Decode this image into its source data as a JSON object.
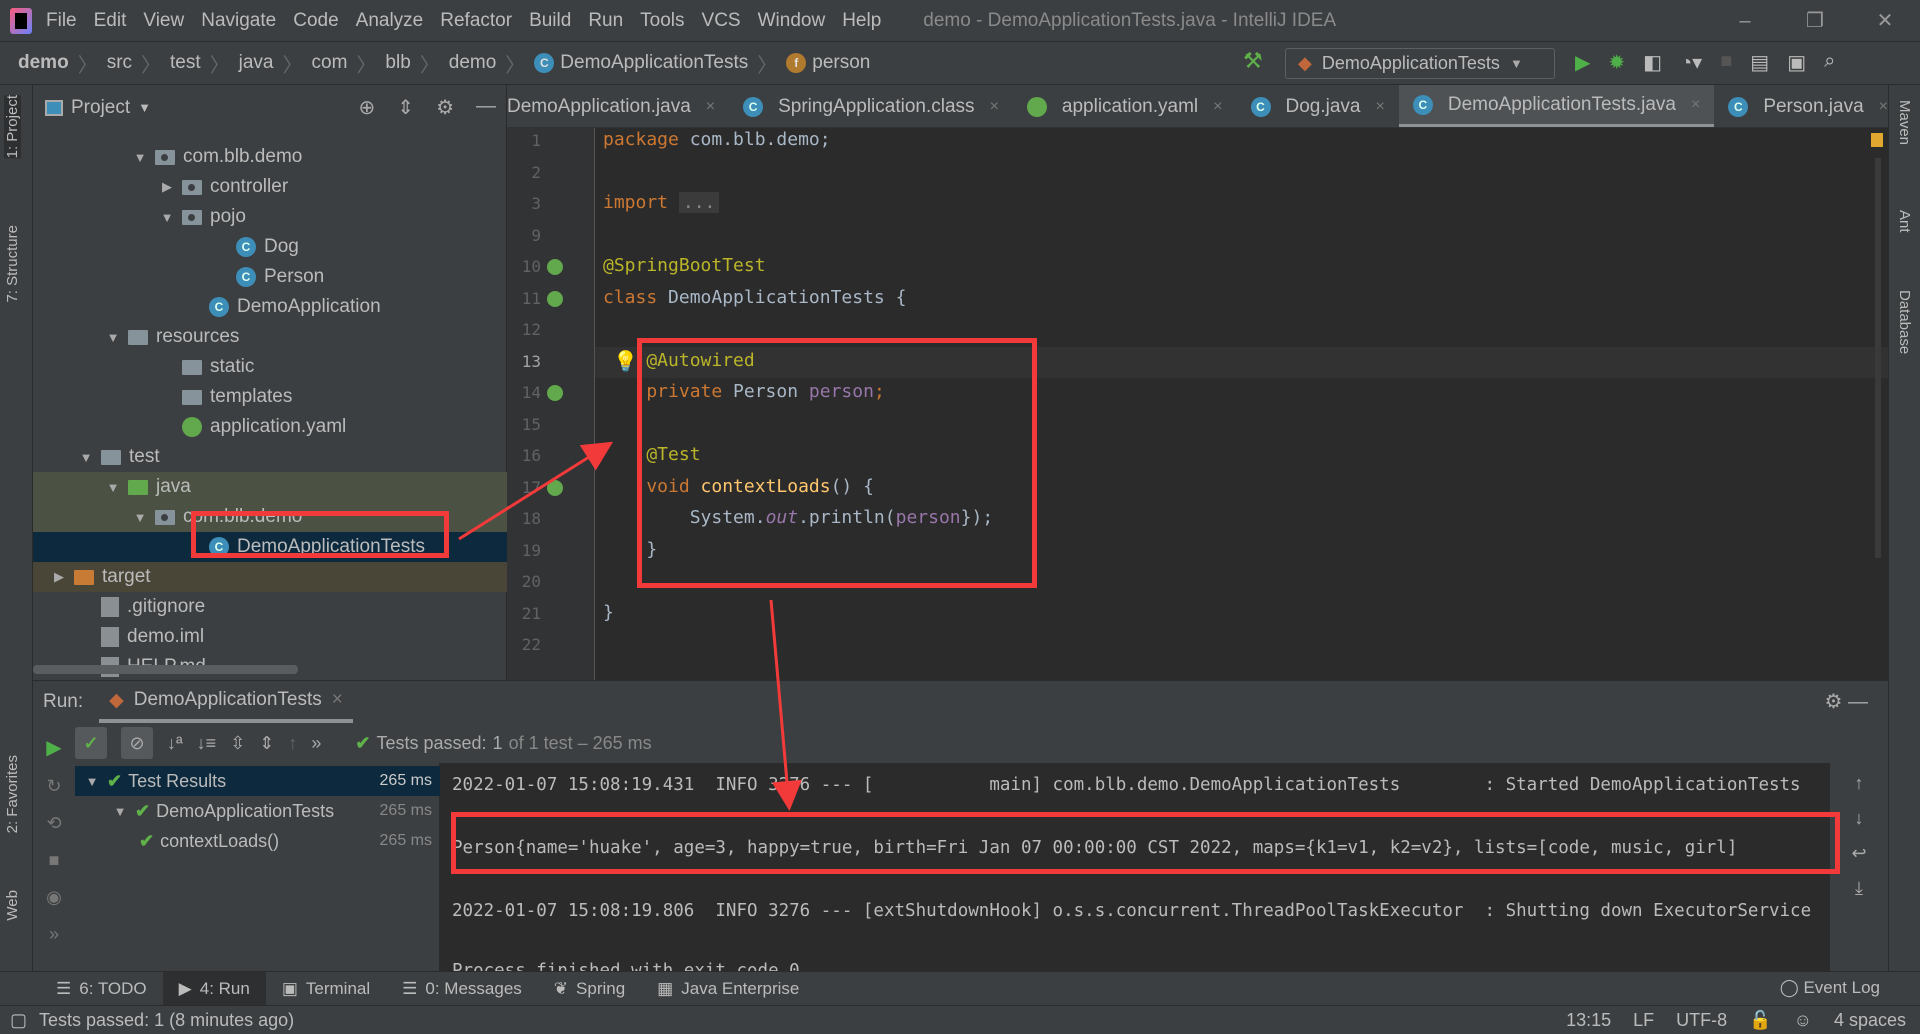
{
  "window": {
    "title": "demo - DemoApplicationTests.java - IntelliJ IDEA",
    "menu": [
      "File",
      "Edit",
      "View",
      "Navigate",
      "Code",
      "Analyze",
      "Refactor",
      "Build",
      "Run",
      "Tools",
      "VCS",
      "Window",
      "Help"
    ]
  },
  "breadcrumb": [
    "demo",
    "src",
    "test",
    "java",
    "com",
    "blb",
    "demo",
    "DemoApplicationTests",
    "person"
  ],
  "run_config": "DemoApplicationTests",
  "left_strip": [
    "1: Project",
    "7: Structure",
    "2: Favorites",
    "Web"
  ],
  "right_strip": [
    "Maven",
    "Ant",
    "Database"
  ],
  "project": {
    "title": "Project",
    "tree": [
      {
        "label": "com.blb.demo",
        "level": 4,
        "arrow": "open",
        "icon": "package"
      },
      {
        "label": "controller",
        "level": 5,
        "arrow": "closed",
        "icon": "package"
      },
      {
        "label": "pojo",
        "level": 5,
        "arrow": "open",
        "icon": "package"
      },
      {
        "label": "Dog",
        "level": 7,
        "arrow": "",
        "icon": "class"
      },
      {
        "label": "Person",
        "level": 7,
        "arrow": "",
        "icon": "class"
      },
      {
        "label": "DemoApplication",
        "level": 6,
        "arrow": "",
        "icon": "class"
      },
      {
        "label": "resources",
        "level": 3,
        "arrow": "open",
        "icon": "folder"
      },
      {
        "label": "static",
        "level": 5,
        "arrow": "",
        "icon": "folder"
      },
      {
        "label": "templates",
        "level": 5,
        "arrow": "",
        "icon": "folder"
      },
      {
        "label": "application.yaml",
        "level": 5,
        "arrow": "",
        "icon": "yaml"
      },
      {
        "label": "test",
        "level": 2,
        "arrow": "open",
        "icon": "folder"
      },
      {
        "label": "java",
        "level": 3,
        "arrow": "open",
        "icon": "folder-green",
        "state": "hl"
      },
      {
        "label": "com.blb.demo",
        "level": 4,
        "arrow": "open",
        "icon": "package",
        "state": "hl"
      },
      {
        "label": "DemoApplicationTests",
        "level": 6,
        "arrow": "",
        "icon": "class",
        "state": "sel"
      },
      {
        "label": "target",
        "level": 1,
        "arrow": "closed",
        "icon": "folder-orange",
        "state": "tgt"
      },
      {
        "label": ".gitignore",
        "level": 2,
        "arrow": "",
        "icon": "file"
      },
      {
        "label": "demo.iml",
        "level": 2,
        "arrow": "",
        "icon": "file"
      },
      {
        "label": "HELP.md",
        "level": 2,
        "arrow": "",
        "icon": "file-md"
      }
    ]
  },
  "tabs": [
    {
      "label": "DemoApplication.java"
    },
    {
      "label": "SpringApplication.class"
    },
    {
      "label": "application.yaml"
    },
    {
      "label": "Dog.java"
    },
    {
      "label": "DemoApplicationTests.java",
      "active": true
    },
    {
      "label": "Person.java"
    }
  ],
  "editor": {
    "current_line": "13",
    "lines": [
      {
        "n": "1",
        "segs": [
          [
            "kw",
            "package "
          ],
          [
            "",
            "com.blb.demo;"
          ]
        ]
      },
      {
        "n": "2",
        "segs": []
      },
      {
        "n": "3",
        "segs": [
          [
            "kw",
            "import "
          ],
          [
            "fd",
            "..."
          ]
        ]
      },
      {
        "n": "9",
        "segs": []
      },
      {
        "n": "10",
        "segs": [
          [
            "an",
            "@SpringBootTest"
          ]
        ]
      },
      {
        "n": "11",
        "segs": [
          [
            "kw",
            "class "
          ],
          [
            "",
            "DemoApplicationTests {"
          ]
        ]
      },
      {
        "n": "12",
        "segs": []
      },
      {
        "n": "13",
        "segs": [
          [
            "an",
            "    @Autowired"
          ]
        ]
      },
      {
        "n": "14",
        "segs": [
          [
            "kw",
            "    private "
          ],
          [
            "",
            "Person "
          ],
          [
            "fld",
            "person"
          ],
          [
            "kw",
            ";"
          ]
        ]
      },
      {
        "n": "15",
        "segs": []
      },
      {
        "n": "16",
        "segs": [
          [
            "an",
            "    @Test"
          ]
        ]
      },
      {
        "n": "17",
        "segs": [
          [
            "kw",
            "    void "
          ],
          [
            "fn",
            "contextLoads"
          ],
          [
            "",
            "() {"
          ]
        ]
      },
      {
        "n": "18",
        "segs": [
          [
            "",
            "        System."
          ],
          [
            "st",
            "out"
          ],
          [
            "",
            ".println("
          ],
          [
            "fld",
            "person"
          ],
          [
            "",
            "});"
          ]
        ]
      },
      {
        "n": "19",
        "segs": [
          [
            "",
            "    }"
          ]
        ]
      },
      {
        "n": "20",
        "segs": []
      },
      {
        "n": "21",
        "segs": [
          [
            "",
            "}"
          ]
        ]
      },
      {
        "n": "22",
        "segs": []
      }
    ]
  },
  "run": {
    "label": "Run:",
    "tab": "DemoApplicationTests",
    "status_prefix": "Tests passed:",
    "status_count": "1",
    "status_suffix": "of 1 test – 265 ms",
    "tree": [
      {
        "label": "Test Results",
        "time": "265 ms"
      },
      {
        "label": "DemoApplicationTests",
        "time": "265 ms"
      },
      {
        "label": "contextLoads()",
        "time": "265 ms"
      }
    ],
    "console": [
      "2022-01-07 15:08:19.431  INFO 3276 --- [           main] com.blb.demo.DemoApplicationTests        : Started DemoApplicationTests",
      "Person{name='huake', age=3, happy=true, birth=Fri Jan 07 00:00:00 CST 2022, maps={k1=v1, k2=v2}, lists=[code, music, girl]",
      "2022-01-07 15:08:19.806  INFO 3276 --- [extShutdownHook] o.s.s.concurrent.ThreadPoolTaskExecutor  : Shutting down ExecutorService",
      "Process finished with exit code 0"
    ]
  },
  "tool_tabs": [
    "6: TODO",
    "4: Run",
    "Terminal",
    "0: Messages",
    "Spring",
    "Java Enterprise"
  ],
  "event_log": "Event Log",
  "status": {
    "message": "Tests passed: 1 (8 minutes ago)",
    "position": "13:15",
    "line_sep": "LF",
    "encoding": "UTF-8",
    "indent": "4 spaces"
  },
  "colors": {
    "annotation": "#f23a3a",
    "keyword": "#cc7832",
    "pass": "#5fb14a"
  }
}
